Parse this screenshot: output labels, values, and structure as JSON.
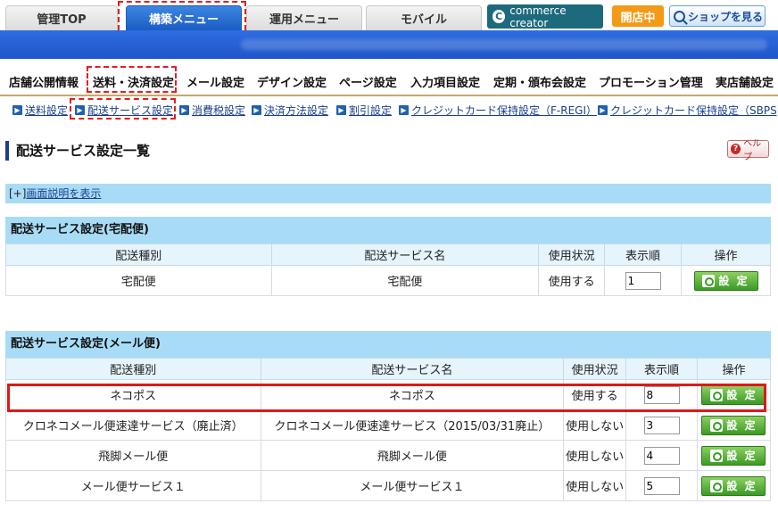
{
  "top_tabs": [
    {
      "label": "管理TOP"
    },
    {
      "label": "構築メニュー"
    },
    {
      "label": "運用メニュー"
    },
    {
      "label": "モバイル"
    }
  ],
  "commerce_creator": "commerce creator",
  "open_status": "開店中",
  "view_shop": "ショップを見る",
  "main_nav": [
    "店舗公開情報",
    "送料・決済設定",
    "メール設定",
    "デザイン設定",
    "ページ設定",
    "入力項目設定",
    "定期・頒布会設定",
    "プロモーション管理",
    "実店舗設定"
  ],
  "sub_nav": [
    "送料設定",
    "配送サービス設定",
    "消費税設定",
    "決済方法設定",
    "割引設定",
    "クレジットカード保持設定（F-REGI）",
    "クレジットカード保持設定（SBPS)"
  ],
  "page_title": "配送サービス設定一覧",
  "help_label": "ヘルプ",
  "desc_toggle_prefix": "[+]",
  "desc_toggle_link": "画面説明を表示",
  "sections": [
    {
      "title": "配送サービス設定(宅配便)",
      "headers": [
        "配送種別",
        "配送サービス名",
        "使用状況",
        "表示順",
        "操作"
      ],
      "rows": [
        {
          "type": "宅配便",
          "name": "宅配便",
          "status": "使用する",
          "order": "1",
          "action": "設 定"
        }
      ]
    },
    {
      "title": "配送サービス設定(メール便)",
      "headers": [
        "配送種別",
        "配送サービス名",
        "使用状況",
        "表示順",
        "操作"
      ],
      "rows": [
        {
          "type": "ネコポス",
          "name": "ネコポス",
          "status": "使用する",
          "order": "8",
          "action": "設 定"
        },
        {
          "type": "クロネコメール便速達サービス（廃止済）",
          "name": "クロネコメール便速達サービス（2015/03/31廃止）",
          "status": "使用しない",
          "order": "3",
          "action": "設 定"
        },
        {
          "type": "飛脚メール便",
          "name": "飛脚メール便",
          "status": "使用しない",
          "order": "4",
          "action": "設 定"
        },
        {
          "type": "メール便サービス１",
          "name": "メール便サービス１",
          "status": "使用しない",
          "order": "5",
          "action": "設 定"
        }
      ]
    }
  ]
}
